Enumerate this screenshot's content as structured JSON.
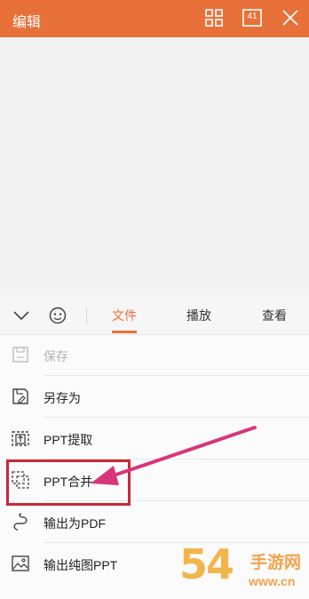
{
  "header": {
    "title": "编辑",
    "page_count": "41",
    "accent_color": "#e8713a",
    "icons": [
      "grid-view-icon",
      "slide-count-icon",
      "close-icon"
    ]
  },
  "toolbar": {
    "icons": [
      "collapse-chevron-icon",
      "emoji-icon"
    ],
    "tabs": [
      {
        "label": "文件",
        "active": true
      },
      {
        "label": "播放",
        "active": false
      },
      {
        "label": "查看",
        "active": false
      }
    ]
  },
  "menu": {
    "items": [
      {
        "label": "保存",
        "icon": "save-icon",
        "enabled": false
      },
      {
        "label": "另存为",
        "icon": "save-as-icon",
        "enabled": true
      },
      {
        "label": "PPT提取",
        "icon": "extract-icon",
        "enabled": true
      },
      {
        "label": "PPT合并",
        "icon": "merge-icon",
        "enabled": true,
        "highlighted": true
      },
      {
        "label": "输出为PDF",
        "icon": "pdf-icon",
        "enabled": true
      },
      {
        "label": "输出纯图PPT",
        "icon": "image-ppt-icon",
        "enabled": true
      }
    ]
  },
  "annotation": {
    "highlight_color": "#c8283a",
    "arrow_color": "#d8357a"
  },
  "watermark": {
    "number": "54",
    "site_name": "手游网",
    "domain": "www.cn"
  }
}
